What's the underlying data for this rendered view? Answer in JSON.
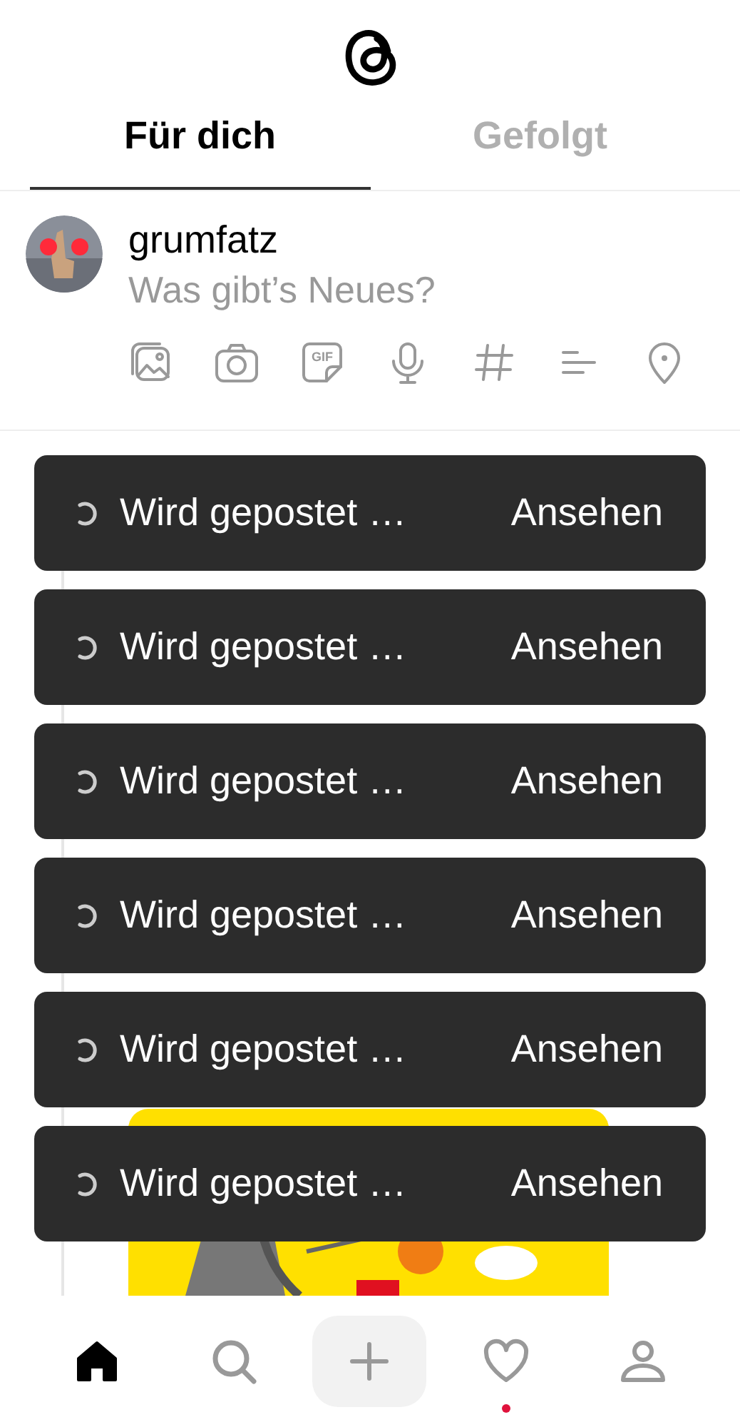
{
  "tabs": [
    {
      "label": "Für dich",
      "selected": true
    },
    {
      "label": "Gefolgt",
      "selected": false
    }
  ],
  "composer": {
    "username": "grumfatz",
    "placeholder": "Was gibt’s Neues?",
    "gif_label": "GIF"
  },
  "toasts": [
    {
      "label": "Wird gepostet …",
      "action": "Ansehen"
    },
    {
      "label": "Wird gepostet …",
      "action": "Ansehen"
    },
    {
      "label": "Wird gepostet …",
      "action": "Ansehen"
    },
    {
      "label": "Wird gepostet …",
      "action": "Ansehen"
    },
    {
      "label": "Wird gepostet …",
      "action": "Ansehen"
    },
    {
      "label": "Wird gepostet …",
      "action": "Ansehen"
    }
  ],
  "nav": [
    {
      "kind": "home",
      "selected": true,
      "unread": false
    },
    {
      "kind": "search",
      "selected": false,
      "unread": false
    },
    {
      "kind": "create",
      "selected": false,
      "unread": false
    },
    {
      "kind": "activity",
      "selected": false,
      "unread": true
    },
    {
      "kind": "profile",
      "selected": false,
      "unread": false
    }
  ]
}
